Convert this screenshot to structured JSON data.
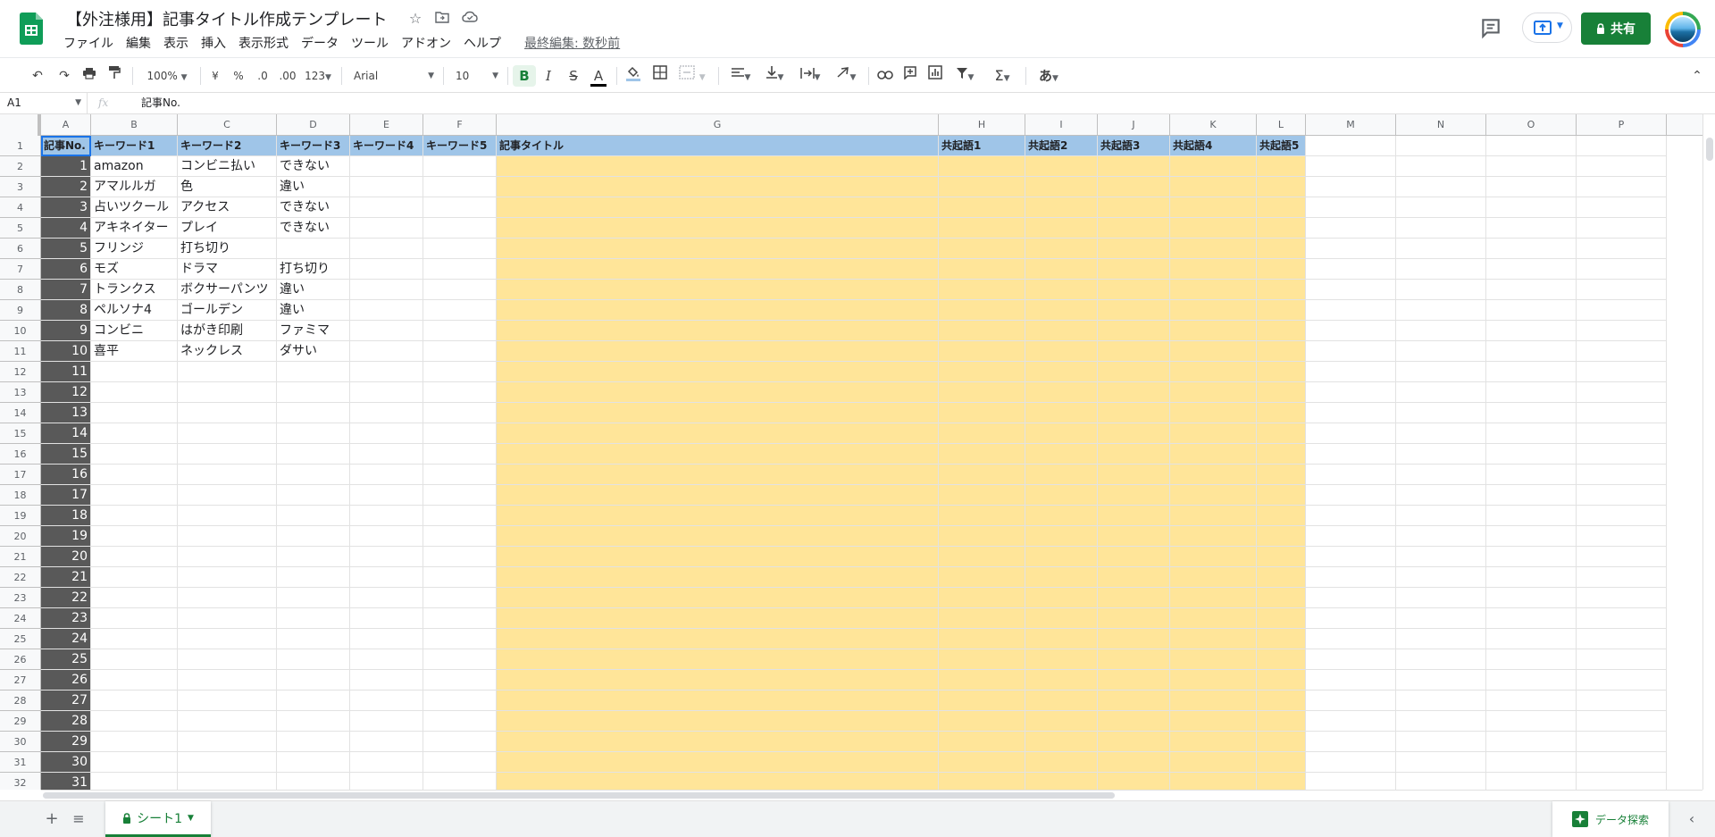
{
  "header": {
    "doc_title": "【外注様用】記事タイトル作成テンプレート",
    "last_edit": "最終編集: 数秒前",
    "share_label": "共有",
    "menu": [
      "ファイル",
      "編集",
      "表示",
      "挿入",
      "表示形式",
      "データ",
      "ツール",
      "アドオン",
      "ヘルプ"
    ]
  },
  "toolbar": {
    "zoom": "100%",
    "currency": "¥",
    "percent": "%",
    "decimal_decrease": ".0",
    "decimal_increase": ".00",
    "format_more": "123",
    "font": "Arial",
    "font_size": "10",
    "bold": "B",
    "italic": "I",
    "strike": "S",
    "text_color": "A",
    "input_tools": "あ"
  },
  "formula_bar": {
    "name_box": "A1",
    "fx": "fx",
    "content": "記事No."
  },
  "grid": {
    "columns": [
      "A",
      "B",
      "C",
      "D",
      "E",
      "F",
      "G",
      "H",
      "I",
      "J",
      "K",
      "L",
      "M",
      "N",
      "O",
      "P"
    ],
    "header_row": [
      "記事No.",
      "キーワード1",
      "キーワード2",
      "キーワード3",
      "キーワード4",
      "キーワード5",
      "記事タイトル",
      "共起語1",
      "共起語2",
      "共起語3",
      "共起語4",
      "共起語5"
    ],
    "row_numbers": [
      "1",
      "2",
      "3",
      "4",
      "5",
      "6",
      "7",
      "8",
      "9",
      "10",
      "11",
      "12",
      "13",
      "14",
      "15",
      "16",
      "17",
      "18",
      "19",
      "20",
      "21",
      "22",
      "23",
      "24",
      "25",
      "26",
      "27",
      "28",
      "29",
      "30",
      "31",
      "32"
    ],
    "article_numbers": [
      "1",
      "2",
      "3",
      "4",
      "5",
      "6",
      "7",
      "8",
      "9",
      "10",
      "11",
      "12",
      "13",
      "14",
      "15",
      "16",
      "17",
      "18",
      "19",
      "20",
      "21",
      "22",
      "23",
      "24",
      "25",
      "26",
      "27",
      "28",
      "29",
      "30",
      "31"
    ],
    "keywords": [
      [
        "amazon",
        "コンビニ払い",
        "できない"
      ],
      [
        "アマルルガ",
        "色",
        "違い"
      ],
      [
        "占いツクール",
        "アクセス",
        "できない"
      ],
      [
        "アキネイター",
        "プレイ",
        "できない"
      ],
      [
        "フリンジ",
        "打ち切り",
        ""
      ],
      [
        "モズ",
        "ドラマ",
        "打ち切り"
      ],
      [
        "トランクス",
        "ボクサーパンツ",
        "違い"
      ],
      [
        "ペルソナ4",
        "ゴールデン",
        "違い"
      ],
      [
        "コンビニ",
        "はがき印刷",
        "ファミマ"
      ],
      [
        "喜平",
        "ネックレス",
        "ダサい"
      ]
    ]
  },
  "bottom_bar": {
    "sheet_name": "シート1",
    "explore_label": "データ探索"
  },
  "colors": {
    "header_fill": "#9fc5e8",
    "number_fill": "#595959",
    "title_fill": "#ffe599",
    "brand": "#188038"
  }
}
